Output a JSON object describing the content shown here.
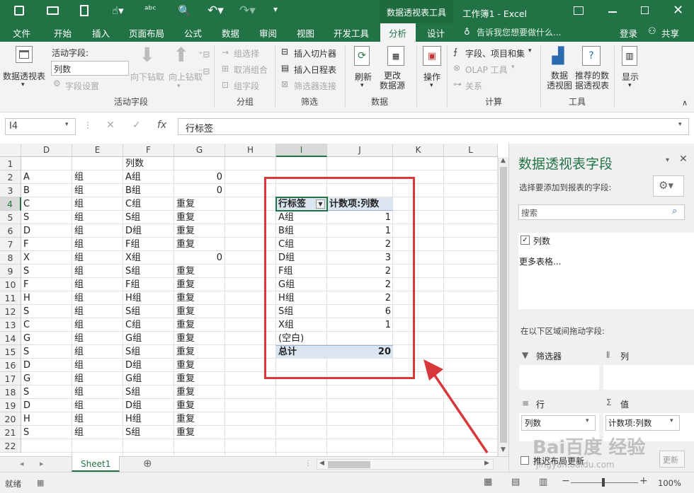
{
  "titlebar": {
    "context_tab": "数据透视表工具",
    "title": "工作簿1 - Excel"
  },
  "tabs": [
    "文件",
    "开始",
    "插入",
    "页面布局",
    "公式",
    "数据",
    "审阅",
    "视图",
    "开发工具",
    "分析",
    "设计"
  ],
  "tell_me": "告诉我您想要做什么...",
  "login": "登录",
  "share": "共享",
  "ribbon": {
    "pivottable": "数据透视表",
    "active_field_label": "活动字段:",
    "active_field_value": "列数",
    "field_settings": "字段设置",
    "drill_down": "向下钻取",
    "drill_up": "向上钻取",
    "group_selection": "组选择",
    "ungroup": "取消组合",
    "group_field": "组字段",
    "insert_slicer": "插入切片器",
    "insert_timeline": "插入日程表",
    "filter_connections": "筛选器连接",
    "refresh": "刷新",
    "change_source": "更改\n数据源",
    "actions": "操作",
    "fields_items_sets": "字段、项目和集",
    "olap_tools": "OLAP 工具",
    "relationships": "关系",
    "pivotchart": "数据\n透视图",
    "recommended": "推荐的数\n据透视表",
    "show": "显示",
    "groups": [
      "活动字段",
      "分组",
      "筛选",
      "数据",
      "计算",
      "工具"
    ]
  },
  "namebox": "I4",
  "formula": "行标签",
  "columns": [
    "D",
    "E",
    "F",
    "G",
    "H",
    "I",
    "J",
    "K",
    "L"
  ],
  "rows": [
    "1",
    "2",
    "3",
    "4",
    "5",
    "6",
    "7",
    "8",
    "9",
    "10",
    "11",
    "12",
    "13",
    "14",
    "15",
    "16",
    "17",
    "18",
    "19",
    "20",
    "21",
    "22"
  ],
  "cells": {
    "D": [
      "",
      "A",
      "B",
      "C",
      "S",
      "D",
      "F",
      "X",
      "S",
      "F",
      "H",
      "S",
      "C",
      "G",
      "S",
      "D",
      "G",
      "S",
      "D",
      "H",
      "S",
      ""
    ],
    "E": [
      "",
      "组",
      "组",
      "组",
      "组",
      "组",
      "组",
      "组",
      "组",
      "组",
      "组",
      "组",
      "组",
      "组",
      "组",
      "组",
      "组",
      "组",
      "组",
      "组",
      "组",
      ""
    ],
    "F": [
      "列数",
      "A组",
      "B组",
      "C组",
      "S组",
      "D组",
      "F组",
      "X组",
      "S组",
      "F组",
      "H组",
      "S组",
      "C组",
      "G组",
      "S组",
      "D组",
      "G组",
      "S组",
      "D组",
      "H组",
      "S组",
      ""
    ],
    "G": [
      "",
      "0",
      "0",
      "重复",
      "重复",
      "重复",
      "重复",
      "0",
      "重复",
      "重复",
      "重复",
      "重复",
      "重复",
      "重复",
      "重复",
      "重复",
      "重复",
      "重复",
      "重复",
      "重复",
      "重复",
      ""
    ]
  },
  "pivot": {
    "header_label": "行标签",
    "header_value": "计数项:列数",
    "rows": [
      {
        "k": "A组",
        "v": "1"
      },
      {
        "k": "B组",
        "v": "1"
      },
      {
        "k": "C组",
        "v": "2"
      },
      {
        "k": "D组",
        "v": "3"
      },
      {
        "k": "F组",
        "v": "2"
      },
      {
        "k": "G组",
        "v": "2"
      },
      {
        "k": "H组",
        "v": "2"
      },
      {
        "k": "S组",
        "v": "6"
      },
      {
        "k": "X组",
        "v": "1"
      },
      {
        "k": "(空白)",
        "v": ""
      }
    ],
    "total_label": "总计",
    "total_value": "20"
  },
  "sheet": "Sheet1",
  "pane": {
    "title": "数据透视表字段",
    "subtitle": "选择要添加到报表的字段:",
    "search": "搜索",
    "field": "列数",
    "more_tables": "更多表格...",
    "drag_hint": "在以下区域间拖动字段:",
    "filters": "筛选器",
    "columns": "列",
    "rows": "行",
    "values": "值",
    "row_field": "列数",
    "value_field": "计数项:列数",
    "defer": "推迟布局更新",
    "update": "更新"
  },
  "status": {
    "ready": "就绪",
    "zoom": "100%"
  },
  "watermark": {
    "main": "Bai百度 经验",
    "url": "jingyan.baidu.com"
  },
  "colors": {
    "excel_green": "#217346",
    "annotation_red": "#d9383a",
    "pivot_header": "#dce6f1"
  }
}
